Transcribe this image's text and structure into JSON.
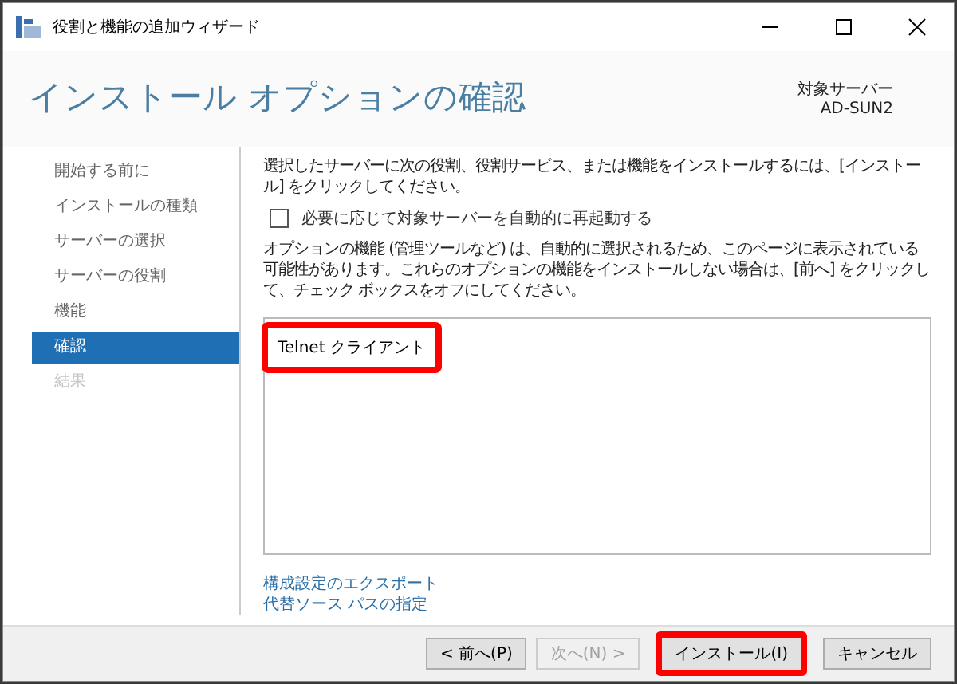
{
  "window": {
    "title": "役割と機能の追加ウィザード"
  },
  "header": {
    "title": "インストール オプションの確認",
    "target_label": "対象サーバー",
    "target_value": "AD-SUN2"
  },
  "sidebar": {
    "items": [
      {
        "label": "開始する前に",
        "selected": false,
        "disabled": false
      },
      {
        "label": "インストールの種類",
        "selected": false,
        "disabled": false
      },
      {
        "label": "サーバーの選択",
        "selected": false,
        "disabled": false
      },
      {
        "label": "サーバーの役割",
        "selected": false,
        "disabled": false
      },
      {
        "label": "機能",
        "selected": false,
        "disabled": false
      },
      {
        "label": "確認",
        "selected": true,
        "disabled": false
      },
      {
        "label": "結果",
        "selected": false,
        "disabled": true
      }
    ]
  },
  "content": {
    "intro": "選択したサーバーに次の役割、役割サービス、または機能をインストールするには、[インストール] をクリックしてください。",
    "restart_option": {
      "label": "必要に応じて対象サーバーを自動的に再起動する",
      "checked": false
    },
    "note": "オプションの機能 (管理ツールなど) は、自動的に選択されるため、このページに表示されている可能性があります。これらのオプションの機能をインストールしない場合は、[前へ] をクリックして、チェック ボックスをオフにしてください。",
    "features": [
      {
        "label": "Telnet クライアント",
        "highlighted": true
      }
    ],
    "links": [
      "構成設定のエクスポート",
      "代替ソース パスの指定"
    ]
  },
  "buttons": [
    {
      "label": "< 前へ(P)",
      "disabled": false,
      "highlighted": false
    },
    {
      "label": "次へ(N) >",
      "disabled": true,
      "highlighted": false
    },
    {
      "label": "インストール(I)",
      "disabled": false,
      "highlighted": true
    },
    {
      "label": "キャンセル",
      "disabled": false,
      "highlighted": false
    }
  ]
}
